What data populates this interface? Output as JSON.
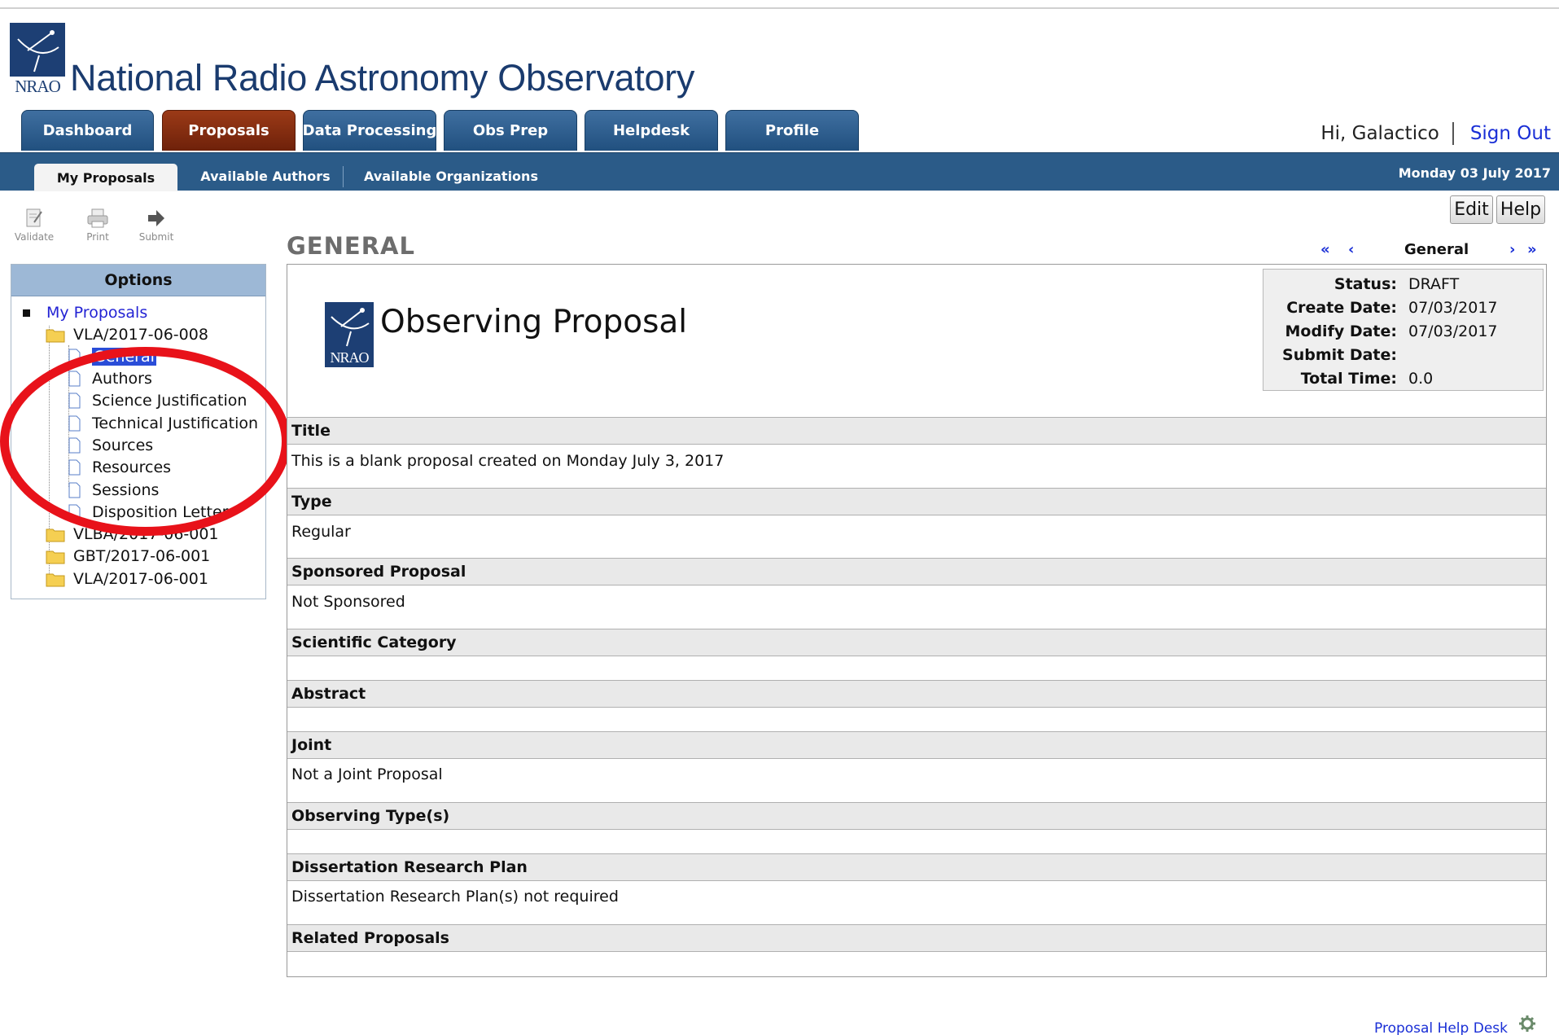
{
  "site": {
    "title": "National Radio Astronomy Observatory",
    "logo_text": "NRAO"
  },
  "main_tabs": [
    {
      "label": "Dashboard",
      "active": false
    },
    {
      "label": "Proposals",
      "active": true
    },
    {
      "label": "Data Processing",
      "active": false
    },
    {
      "label": "Obs Prep",
      "active": false
    },
    {
      "label": "Helpdesk",
      "active": false
    },
    {
      "label": "Profile",
      "active": false
    }
  ],
  "user": {
    "greeting": "Hi, Galactico",
    "sign_out": "Sign Out"
  },
  "sub_tabs": [
    {
      "label": "My Proposals",
      "active": true
    },
    {
      "label": "Available Authors",
      "active": false
    },
    {
      "label": "Available Organizations",
      "active": false
    }
  ],
  "date": "Monday 03 July 2017",
  "toolbar": [
    {
      "label": "Validate",
      "icon": "validate-icon"
    },
    {
      "label": "Print",
      "icon": "print-icon"
    },
    {
      "label": "Submit",
      "icon": "submit-arrow-icon"
    }
  ],
  "buttons": {
    "edit": "Edit",
    "help": "Help"
  },
  "options": {
    "title": "Options",
    "root": "My Proposals",
    "folders": [
      {
        "label": "VLA/2017-06-008",
        "expanded": true,
        "pages": [
          {
            "label": "General",
            "selected": true
          },
          {
            "label": "Authors"
          },
          {
            "label": "Science Justification"
          },
          {
            "label": "Technical Justification"
          },
          {
            "label": "Sources"
          },
          {
            "label": "Resources"
          },
          {
            "label": "Sessions"
          },
          {
            "label": "Disposition Letter"
          }
        ]
      },
      {
        "label": "VLBA/2017-06-001",
        "expanded": false
      },
      {
        "label": "GBT/2017-06-001",
        "expanded": false
      },
      {
        "label": "VLA/2017-06-001",
        "expanded": false
      }
    ]
  },
  "section": {
    "title": "GENERAL",
    "pager_label": "General",
    "pager_first": "«",
    "pager_prev": "‹",
    "pager_next": "›",
    "pager_last": "»"
  },
  "proposal": {
    "heading": "Observing Proposal",
    "status": [
      {
        "key": "Status:",
        "value": "DRAFT"
      },
      {
        "key": "Create Date:",
        "value": "07/03/2017"
      },
      {
        "key": "Modify Date:",
        "value": "07/03/2017"
      },
      {
        "key": "Submit Date:",
        "value": ""
      },
      {
        "key": "Total Time:",
        "value": "0.0"
      }
    ],
    "fields": [
      {
        "label": "Title",
        "value": "This is a blank proposal created on Monday July 3, 2017"
      },
      {
        "label": "Type",
        "value": "Regular"
      },
      {
        "label": "Sponsored Proposal",
        "value": "Not Sponsored"
      },
      {
        "label": "Scientific Category",
        "value": ""
      },
      {
        "label": "Abstract",
        "value": ""
      },
      {
        "label": "Joint",
        "value": "Not a Joint Proposal"
      },
      {
        "label": "Observing Type(s)",
        "value": ""
      },
      {
        "label": "Dissertation Research Plan",
        "value": "Dissertation Research Plan(s) not required"
      },
      {
        "label": "Related Proposals",
        "value": ""
      }
    ]
  },
  "footer": {
    "help_desk": "Proposal Help Desk"
  },
  "colors": {
    "nav_blue": "#2b5b88",
    "active_tab": "#7f2a0f",
    "link_blue": "#1a2fd6",
    "annotation_red": "#e8121a"
  }
}
